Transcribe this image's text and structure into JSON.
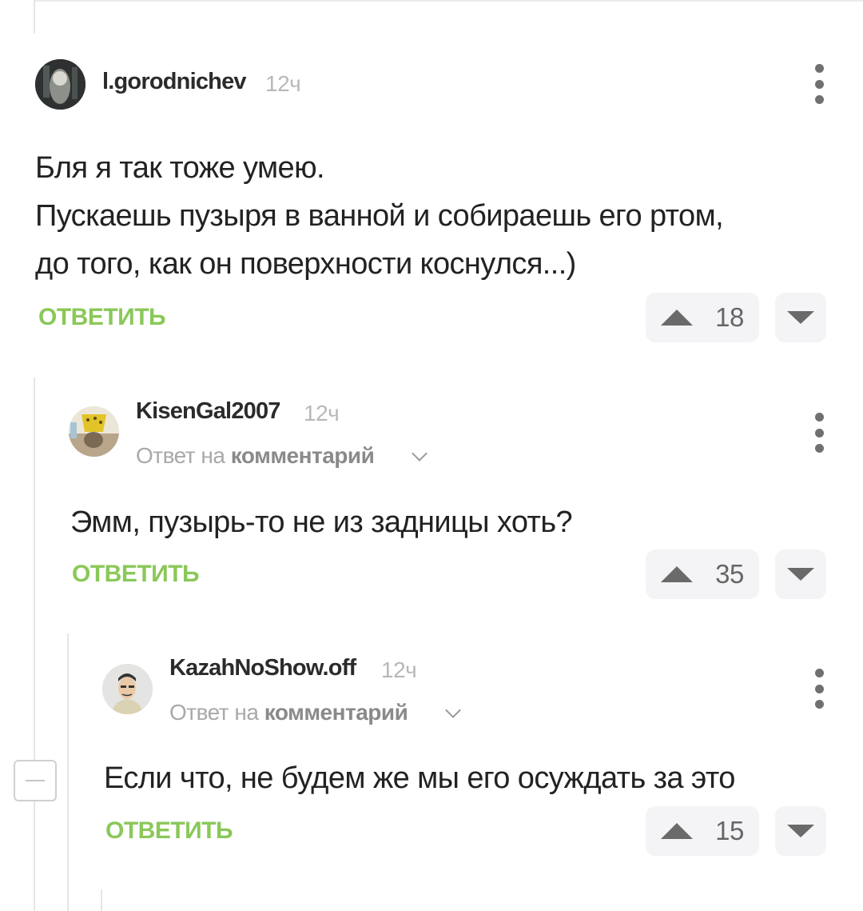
{
  "comments": [
    {
      "username": "l.gorodnichev",
      "time": "12ч",
      "lines": [
        "Бля я так тоже умею.",
        "Пускаешь пузыря в ванной и собираешь его ртом,",
        "до того, как он поверхности коснулся...)"
      ],
      "reply_label": "ОТВЕТИТЬ",
      "votes": "18"
    },
    {
      "username": "KisenGal2007",
      "time": "12ч",
      "reply_to_prefix": "Ответ на",
      "reply_to_link": "комментарий",
      "lines": [
        "Эмм, пузырь-то не из задницы хоть?"
      ],
      "reply_label": "ОТВЕТИТЬ",
      "votes": "35"
    },
    {
      "username": "KazahNoShow.off",
      "time": "12ч",
      "reply_to_prefix": "Ответ на",
      "reply_to_link": "комментарий",
      "lines": [
        "Если что, не будем же мы его осуждать за это"
      ],
      "reply_label": "ОТВЕТИТЬ",
      "votes": "15"
    }
  ],
  "icons": {
    "more": "more-vertical-icon",
    "upvote": "triangle-up-icon",
    "downvote": "triangle-down-icon",
    "collapse": "minus-icon",
    "chevron": "chevron-down-icon"
  },
  "colors": {
    "accent_green": "#8ac858",
    "vote_bg": "#f4f4f6",
    "thread_line": "#e6e6e6"
  }
}
